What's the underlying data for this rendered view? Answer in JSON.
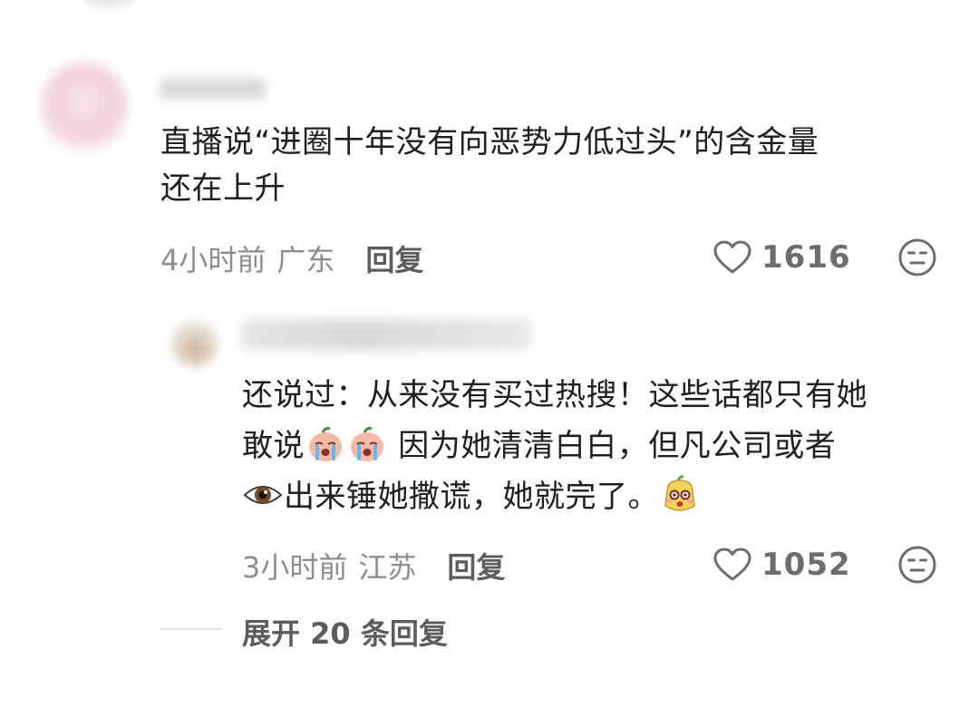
{
  "comment": {
    "text_line1": "直播说“进圈十年没有向恶势力低过头”的含金量",
    "text_line2": "还在上升",
    "time": "4小时前",
    "region": "广东",
    "reply_label": "回复",
    "likes": "1616"
  },
  "reply": {
    "text_line1": "还说过：从来没有买过热搜！这些话都只有她",
    "text_line2a": "敢说",
    "text_line2b": " 因为她清清白白，但凡公司或者",
    "text_line3": "出来锤她撒谎，她就完了。",
    "emojis": [
      "crying-peach-icon",
      "crying-peach-icon",
      "eye-icon",
      "shocked-mascot-icon"
    ],
    "time": "3小时前",
    "region": "江苏",
    "reply_label": "回复",
    "likes": "1052"
  },
  "expand": {
    "label": "展开 20 条回复"
  },
  "colors": {
    "text_primary": "#1f1f1f",
    "text_meta": "#8d8d8d",
    "text_action": "#5c5c5c",
    "icon_stroke": "#6d6d6d"
  }
}
